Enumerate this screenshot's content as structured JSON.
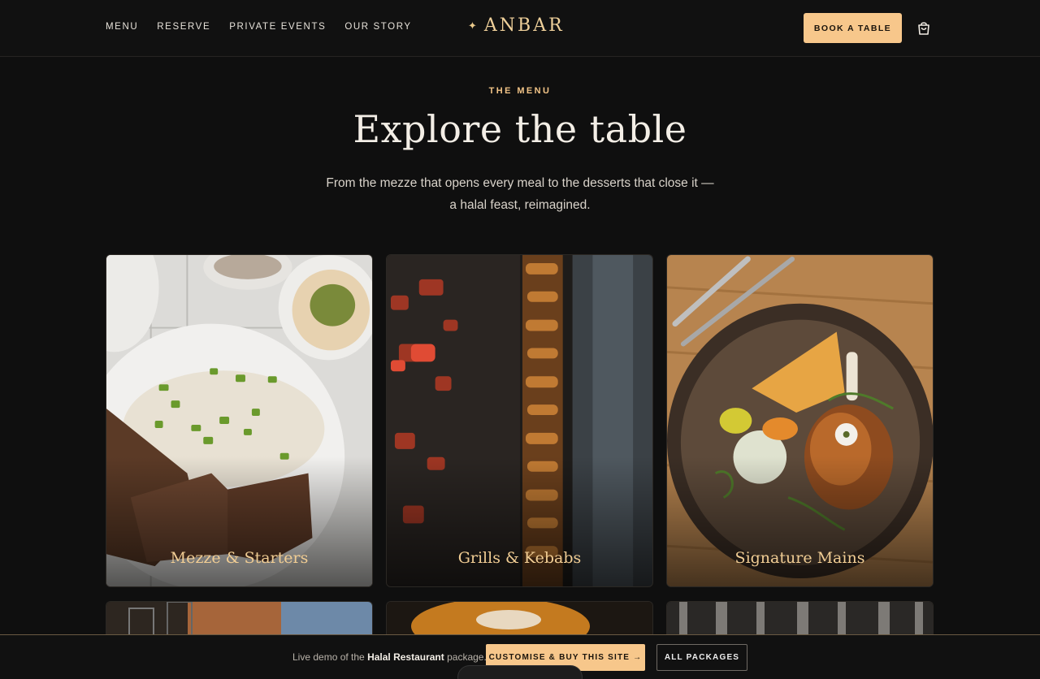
{
  "nav": {
    "items": [
      "MENU",
      "RESERVE",
      "PRIVATE EVENTS",
      "OUR STORY"
    ],
    "brand": "ANBAR",
    "book_label": "BOOK A TABLE",
    "cart_icon": "shopping-bag-icon"
  },
  "hero": {
    "eyebrow": "THE MENU",
    "title": "Explore the table",
    "subtitle": "From the mezze that opens every meal to the desserts that close it — a halal feast, reimagined."
  },
  "categories": [
    {
      "label": "Mezze & Starters"
    },
    {
      "label": "Grills & Kebabs"
    },
    {
      "label": "Signature Mains"
    }
  ],
  "promo": {
    "prefix": "Live demo of the ",
    "package": "Halal Restaurant",
    "suffix": " package.",
    "buy_label": "CUSTOMISE & BUY THIS SITE →",
    "packages_label": "ALL PACKAGES"
  },
  "colors": {
    "accent": "#f7c78b",
    "background": "#0f0f0f",
    "gold_text": "#f1cd94"
  }
}
